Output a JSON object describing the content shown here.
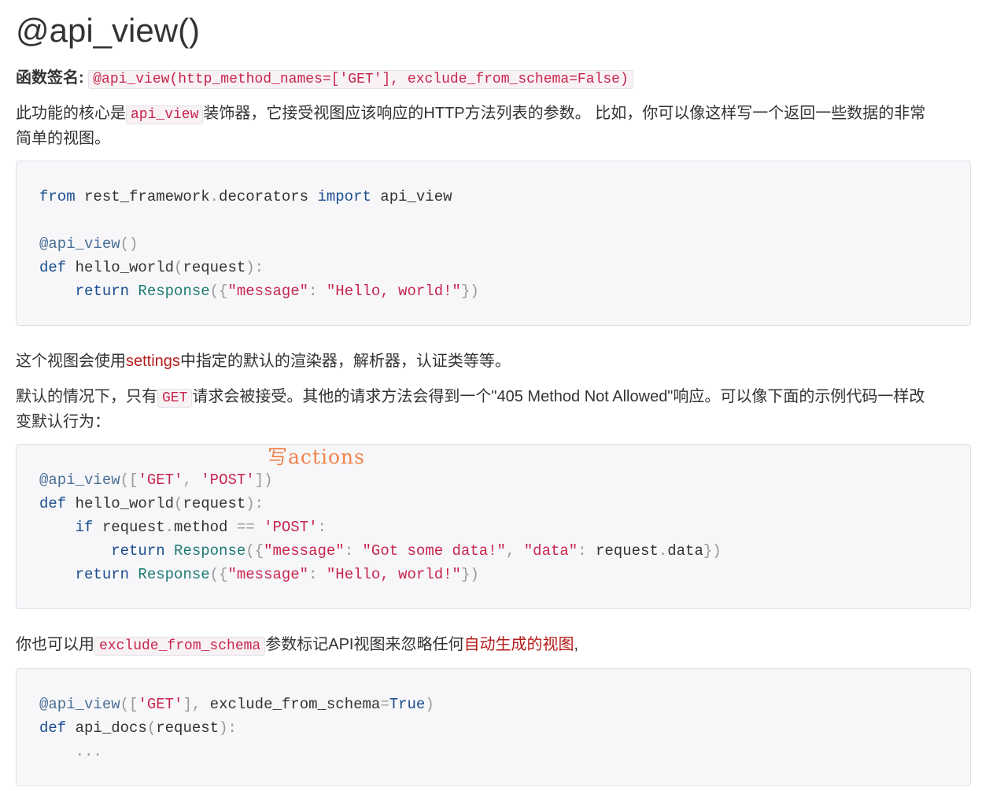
{
  "title": "@api_view()",
  "signature": {
    "label": "函数签名:",
    "code": "@api_view(http_method_names=['GET'], exclude_from_schema=False)"
  },
  "p1": {
    "a": "此功能的核心是",
    "code": "api_view",
    "b": "装饰器，它接受视图应该响应的HTTP方法列表的参数。 比如，你可以像这样写一个返回一些数据的非常",
    "c": "简单的视图。"
  },
  "code1": {
    "l1": [
      "from",
      " rest_framework",
      ".",
      "decorators ",
      "import",
      " api_view"
    ],
    "l3": [
      "@api_view",
      "()"
    ],
    "l4": [
      "def",
      " hello_world",
      "(",
      "request",
      "):"
    ],
    "l5": [
      "    ",
      "return",
      " Response",
      "({",
      "\"message\"",
      ": ",
      "\"Hello, world!\"",
      "})"
    ]
  },
  "p2": {
    "a": "这个视图会使用",
    "link": "settings",
    "b": "中指定的默认的渲染器，解析器，认证类等等。"
  },
  "p3": {
    "a": "默认的情况下，只有",
    "code": "GET",
    "b": "请求会被接受。其他的请求方法会得到一个\"405 Method Not Allowed\"响应。可以像下面的示例代码一样改",
    "c": "变默认行为："
  },
  "annotation": "写actions",
  "code2": {
    "l1": [
      "@api_view",
      "([",
      "'GET'",
      ", ",
      "'POST'",
      "])"
    ],
    "l2": [
      "def",
      " hello_world",
      "(",
      "request",
      "):"
    ],
    "l3": [
      "    ",
      "if",
      " request",
      ".",
      "method ",
      "==",
      " ",
      "'POST'",
      ":"
    ],
    "l4": [
      "        ",
      "return",
      " Response",
      "({",
      "\"message\"",
      ": ",
      "\"Got some data!\"",
      ", ",
      "\"data\"",
      ": ",
      "request",
      ".",
      "data",
      "})"
    ],
    "l5": [
      "    ",
      "return",
      " Response",
      "({",
      "\"message\"",
      ": ",
      "\"Hello, world!\"",
      "})"
    ]
  },
  "p4": {
    "a": "你也可以用",
    "code": "exclude_from_schema",
    "b": "参数标记API视图来忽略任何",
    "link": "自动生成的视图",
    "c": ","
  },
  "code3": {
    "l1": [
      "@api_view",
      "([",
      "'GET'",
      "], ",
      "exclude_from_schema",
      "=",
      "True",
      ")"
    ],
    "l2": [
      "def",
      " api_docs",
      "(",
      "request",
      "):"
    ],
    "l3": [
      "    ",
      "..."
    ]
  }
}
